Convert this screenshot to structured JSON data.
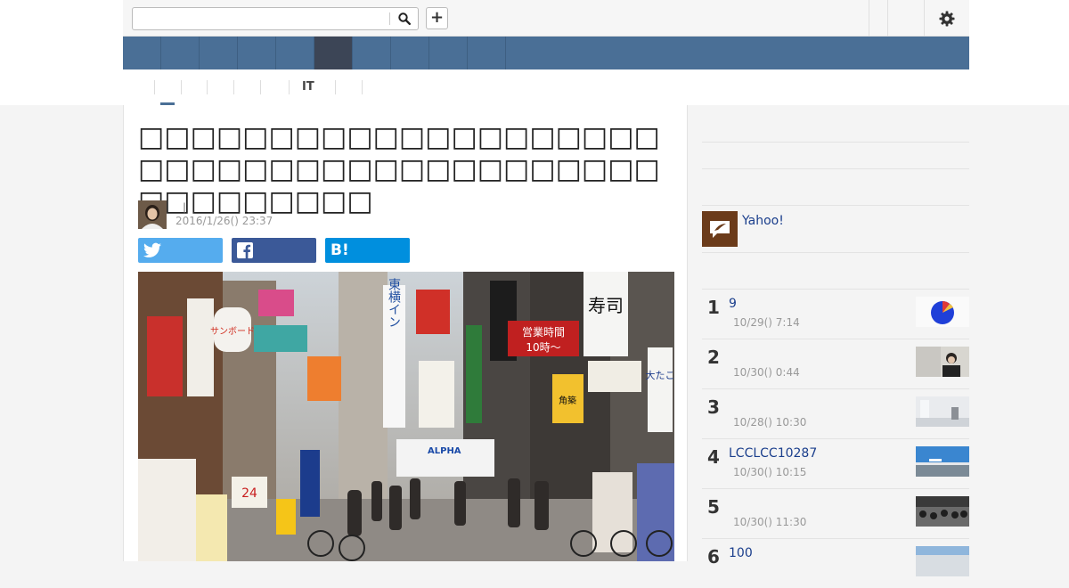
{
  "search": {
    "value": "",
    "placeholder": ""
  },
  "toolbar": {
    "add_label": "+"
  },
  "nav": {
    "items": [
      "",
      "",
      "",
      "",
      "",
      "",
      "",
      "",
      "",
      ""
    ]
  },
  "subnav": {
    "items": [
      "",
      "",
      "",
      "",
      "",
      "IT",
      ""
    ]
  },
  "article": {
    "headline": "□□□□□□□□□□□□□□□□□□□□□□□□□□□□□□□□□□□□□□□□□□□□□□□□□",
    "author_separator": "|",
    "date": "2016/1/26() 23:37"
  },
  "share": {
    "twitter_label": "",
    "facebook_label": "",
    "hatena_label": "B!"
  },
  "sidebar": {
    "yahoo_label": "Yahoo!",
    "ranking": [
      {
        "rank": "1",
        "title": "9",
        "date": "10/29() 7:14"
      },
      {
        "rank": "2",
        "title": "",
        "date": "10/30() 0:44"
      },
      {
        "rank": "3",
        "title": "",
        "date": "10/28() 10:30"
      },
      {
        "rank": "4",
        "title": "LCCLCC10287",
        "date": "10/30() 10:15"
      },
      {
        "rank": "5",
        "title": "",
        "date": "10/30() 11:30"
      },
      {
        "rank": "6",
        "title": "100",
        "date": ""
      }
    ]
  },
  "colors": {
    "nav_bg": "#4a6f96",
    "nav_active": "#3c4556",
    "twitter": "#55acee",
    "facebook": "#3b5998",
    "hatena": "#008fde",
    "link": "#1a3e8c"
  },
  "icons": [
    "search-icon",
    "plus-icon",
    "gear-icon",
    "twitter-icon",
    "facebook-icon",
    "hatena-bookmark-icon",
    "yahoo-creator-icon"
  ],
  "photo_signs": {
    "sign_a": "東横イン",
    "sign_b": "営業時間",
    "sign_c": "10時～",
    "sign_d": "寿司",
    "sign_e": "ALPHA",
    "sign_f": "24",
    "sign_g": "サンボード",
    "sign_h": "角築",
    "sign_i": "大たこ"
  }
}
